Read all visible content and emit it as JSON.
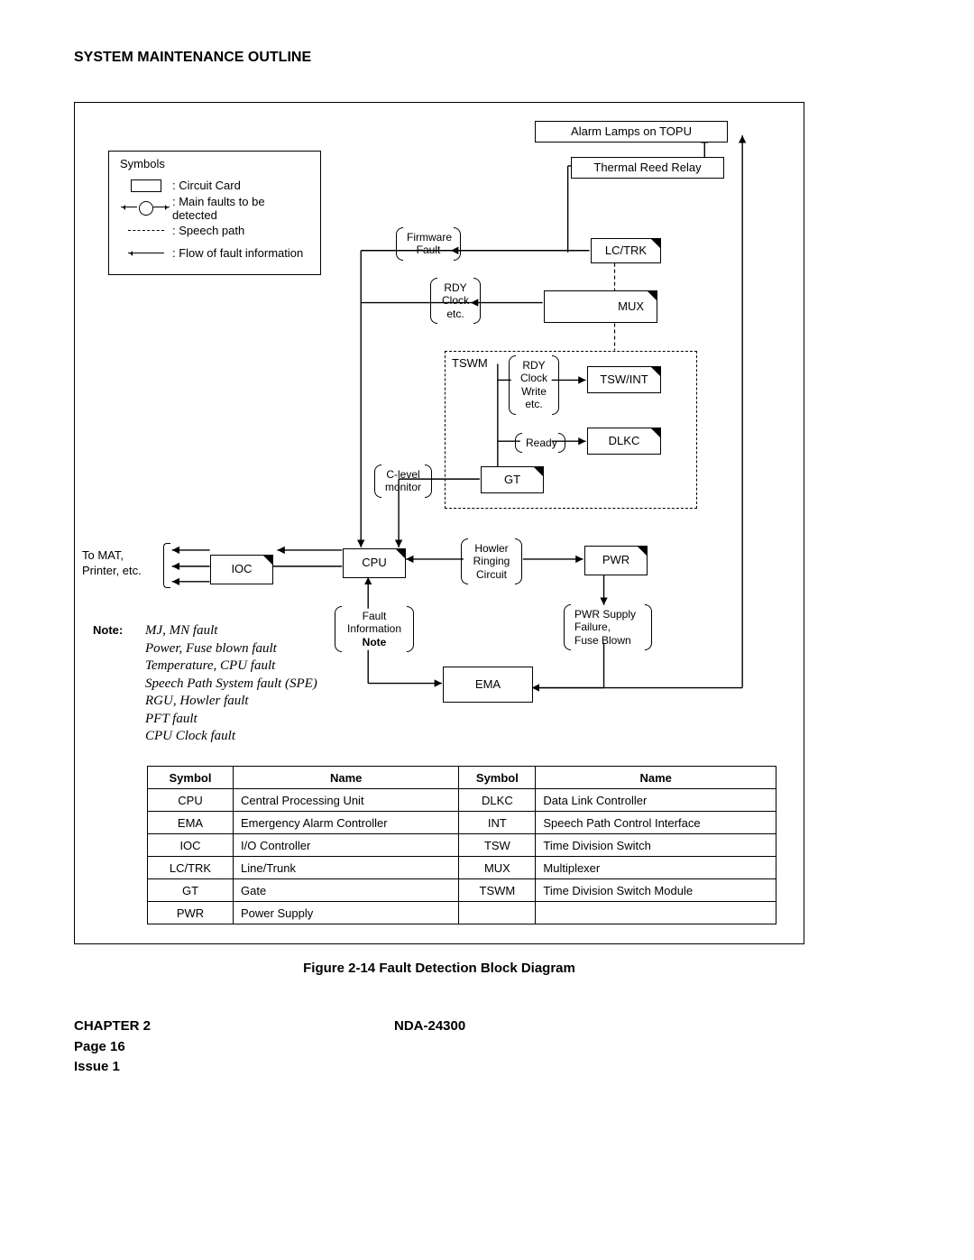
{
  "header": "SYSTEM MAINTENANCE OUTLINE",
  "legend": {
    "title": "Symbols",
    "rows": [
      {
        "label": ": Circuit Card"
      },
      {
        "label": ": Main faults to be detected"
      },
      {
        "label": ": Speech path"
      },
      {
        "label": ": Flow of fault information"
      }
    ]
  },
  "nodes": {
    "alarm_lamps": "Alarm Lamps on TOPU",
    "thermal_reed": "Thermal Reed Relay",
    "lc_trk": "LC/TRK",
    "mux": "MUX",
    "tswm_lbl": "TSWM",
    "tsw_int": "TSW/INT",
    "dlkc": "DLKC",
    "gt": "GT",
    "cpu": "CPU",
    "ioc": "IOC",
    "pwr": "PWR",
    "ema": "EMA"
  },
  "bubbles": {
    "firmware": "Firmware\nFault",
    "rdy_clock_etc": "RDY\nClock\netc.",
    "rdy_clock_write": "RDY\nClock\nWrite\netc.",
    "ready": "Ready",
    "clevel": "C-level\nmonitor",
    "howler": "Howler\nRinging\nCircuit",
    "fault_info": "Fault\nInformation",
    "pwr_supply": "PWR Supply\nFailure,\nFuse Blown"
  },
  "labels": {
    "to_mat": "To MAT,\nPrinter, etc.",
    "note_word": "Note:",
    "note_word2": "Note",
    "note_body": "MJ, MN fault\nPower, Fuse blown fault\nTemperature, CPU fault\nSpeech Path System fault (SPE)\nRGU, Howler fault\nPFT fault\nCPU Clock fault"
  },
  "table": {
    "headers": [
      "Symbol",
      "Name",
      "Symbol",
      "Name"
    ],
    "rows": [
      [
        "CPU",
        "Central Processing Unit",
        "DLKC",
        "Data Link Controller"
      ],
      [
        "EMA",
        "Emergency Alarm Controller",
        "INT",
        "Speech Path Control Interface"
      ],
      [
        "IOC",
        "I/O Controller",
        "TSW",
        "Time Division Switch"
      ],
      [
        "LC/TRK",
        "Line/Trunk",
        "MUX",
        "Multiplexer"
      ],
      [
        "GT",
        "Gate",
        "TSWM",
        "Time Division Switch Module"
      ],
      [
        "PWR",
        "Power Supply",
        "",
        ""
      ]
    ]
  },
  "caption": "Figure 2-14   Fault Detection Block Diagram",
  "footer": {
    "chapter": "CHAPTER 2",
    "page": "Page 16",
    "issue": "Issue 1",
    "docnum": "NDA-24300"
  }
}
